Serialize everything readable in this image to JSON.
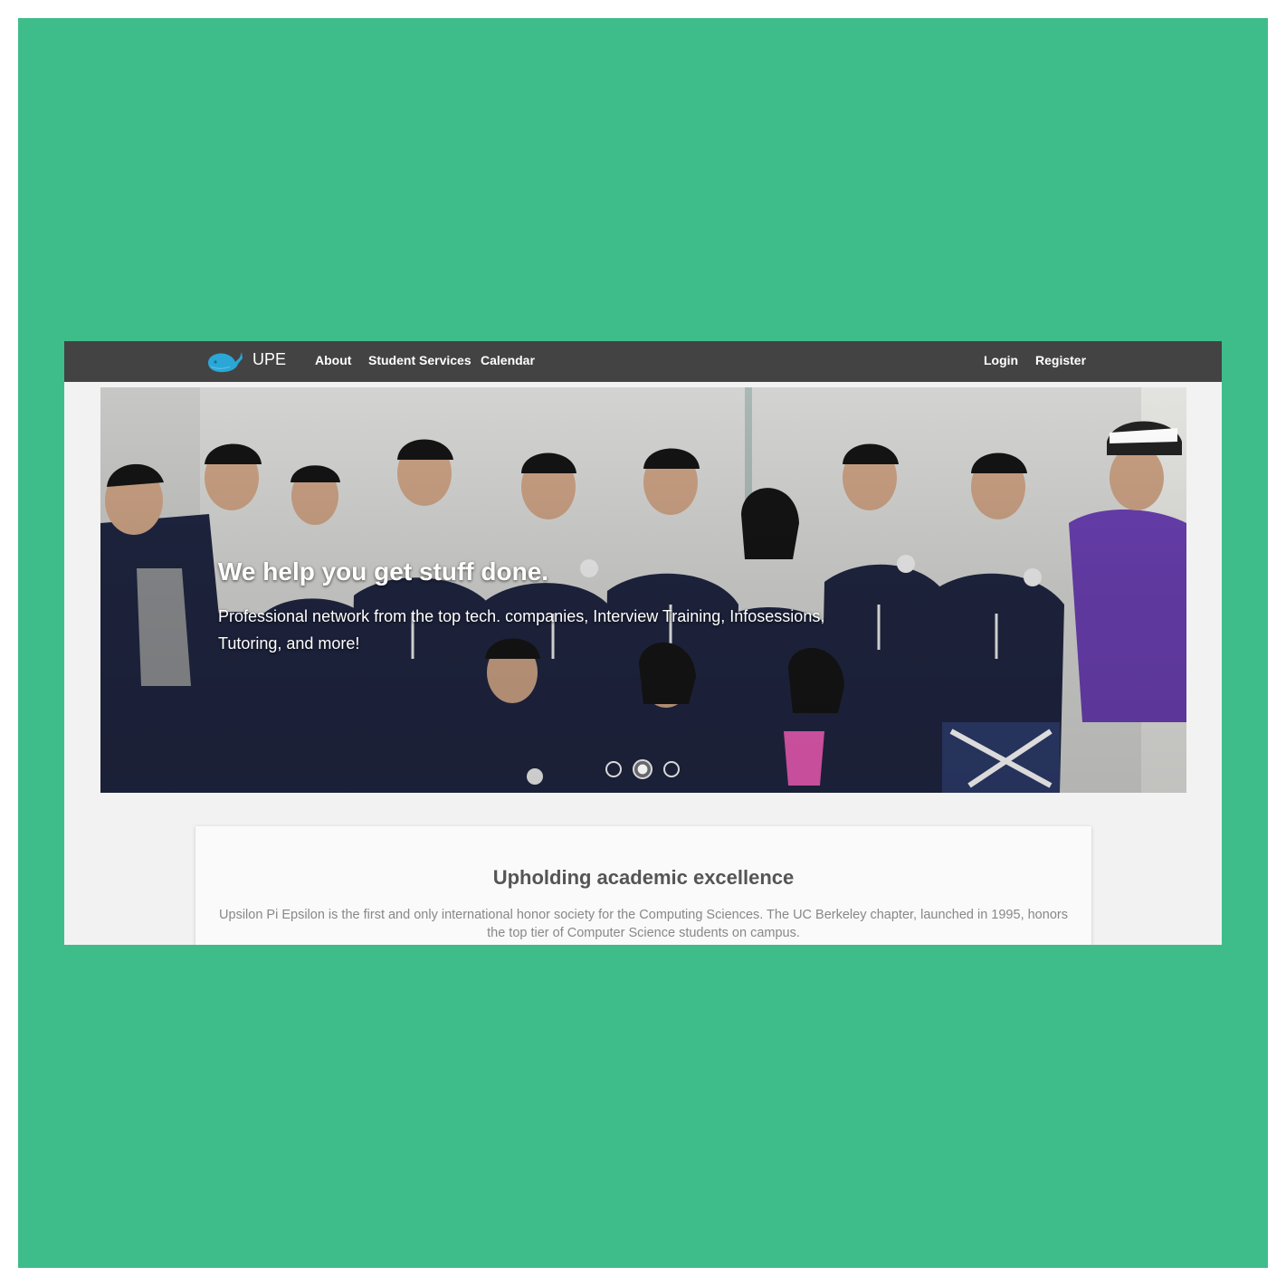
{
  "colors": {
    "background": "#3ebd8b",
    "navbar": "#434343",
    "page": "#f2f2f2",
    "logo": "#2aa7d6",
    "heading": "#555555",
    "body_text": "#888888"
  },
  "navbar": {
    "logo_icon": "whale-icon",
    "brand": "UPE",
    "links": [
      {
        "label": "About"
      },
      {
        "label": "Student Services"
      },
      {
        "label": "Calendar"
      }
    ],
    "auth": {
      "login": "Login",
      "register": "Register"
    }
  },
  "hero": {
    "headline": "We help you get stuff done.",
    "subtext": "Professional network from the top tech. companies, Interview Training, Infosessions, Tutoring, and more!",
    "carousel": {
      "slide_count": 3,
      "active_slide": 2
    }
  },
  "intro": {
    "title": "Upholding academic excellence",
    "text": "Upsilon Pi Epsilon is the first and only international honor society for the Computing Sciences. The UC Berkeley chapter, launched in 1995, honors the top tier of Computer Science students on campus."
  }
}
